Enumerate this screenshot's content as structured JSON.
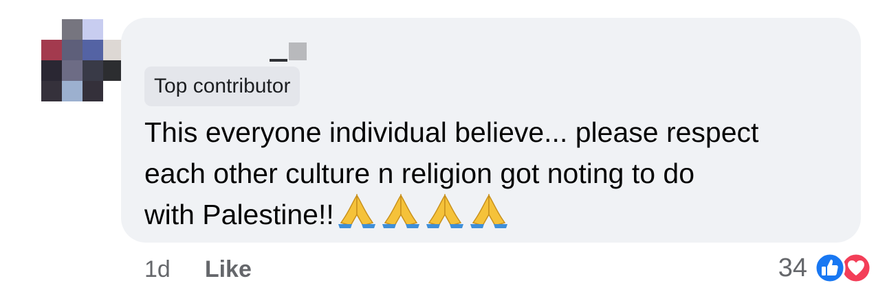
{
  "comment": {
    "badge": "Top contributor",
    "text_lines": [
      "This everyone individual believe... please respect",
      "each other culture n religion got noting to do",
      "with Palestine!!"
    ],
    "emoji": [
      "🙏",
      "🙏",
      "🙏",
      "🙏"
    ],
    "timestamp": "1d",
    "like_label": "Like",
    "reaction_count": "34",
    "reaction_icons": [
      "like-reaction-icon",
      "love-reaction-icon"
    ]
  },
  "colors": {
    "bubble_bg": "#f0f2f5",
    "badge_bg": "#e4e6eb",
    "meta_text": "#65676b",
    "like_blue": "#1877f2",
    "love_red": "#f33e58"
  }
}
